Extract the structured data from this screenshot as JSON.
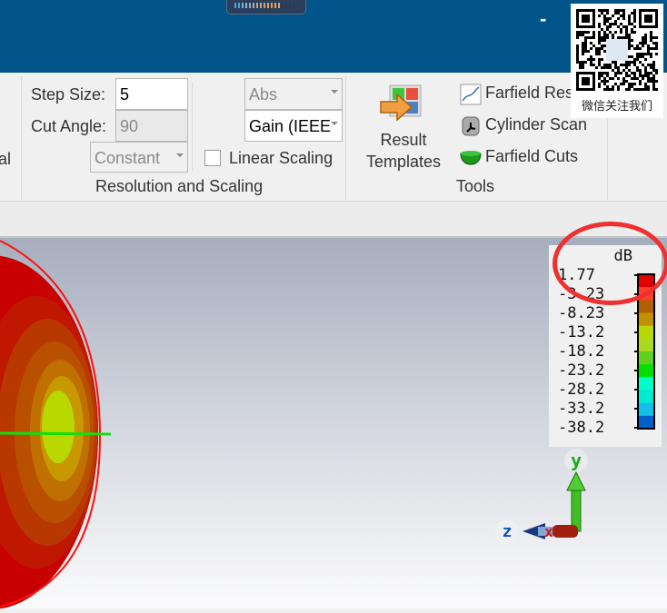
{
  "ribbon": {
    "left_partial_label": "al",
    "resolution": {
      "step_size_label": "Step Size:",
      "step_size_value": "5",
      "cut_angle_label": "Cut Angle:",
      "cut_angle_value": "90",
      "constant_select": "Constant",
      "abs_select": "Abs",
      "gain_select": "Gain (IEEE",
      "linear_scaling_label": "Linear Scaling",
      "linear_scaling_checked": false,
      "group_label": "Resolution and Scaling"
    },
    "tools": {
      "result_templates_label": "Result Templates",
      "farfield_result_label": "Farfield Res",
      "cylinder_scan_label": "Cylinder Scan",
      "farfield_cuts_label": "Farfield Cuts",
      "group_label": "Tools"
    }
  },
  "titlebar": {
    "minimize": "-"
  },
  "qr": {
    "caption": "微信关注我们"
  },
  "legend": {
    "unit": "dB",
    "values": [
      "1.77",
      "-3.23",
      "-8.23",
      "-13.2",
      "-18.2",
      "-23.2",
      "-28.2",
      "-33.2",
      "-38.2"
    ],
    "colors": [
      "#e00000",
      "#ff4030",
      "#b06000",
      "#c09000",
      "#b8d800",
      "#a8d820",
      "#60d020",
      "#00e000",
      "#00ffc8",
      "#00e8d0",
      "#10c0e8",
      "#0060c8"
    ]
  },
  "axes": {
    "x": "x",
    "y": "y",
    "z": "z"
  }
}
